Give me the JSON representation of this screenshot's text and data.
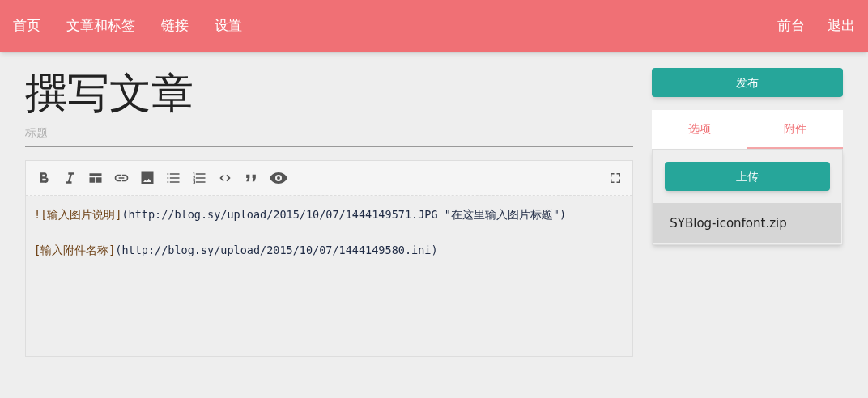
{
  "nav": {
    "left": [
      "首页",
      "文章和标签",
      "链接",
      "设置"
    ],
    "right": [
      "前台",
      "退出"
    ]
  },
  "page_title": "撰写文章",
  "title_field": {
    "placeholder": "标题"
  },
  "editor": {
    "lines": [
      [
        {
          "kind": "label",
          "text": "![输入图片说明]"
        },
        {
          "kind": "link",
          "text": "(http://blog.sy/upload/2015/10/07/1444149571.JPG \"在这里输入图片标题\")"
        }
      ],
      [
        {
          "kind": "label",
          "text": "[输入附件名称]"
        },
        {
          "kind": "link",
          "text": "(http://blog.sy/upload/2015/10/07/1444149580.ini)"
        }
      ]
    ]
  },
  "publish_button": "发布",
  "tabs": [
    {
      "label": "选项",
      "selected": false
    },
    {
      "label": "附件",
      "selected": true
    }
  ],
  "upload_button": "上传",
  "attachments": [
    "SYBlog-iconfont.zip"
  ]
}
